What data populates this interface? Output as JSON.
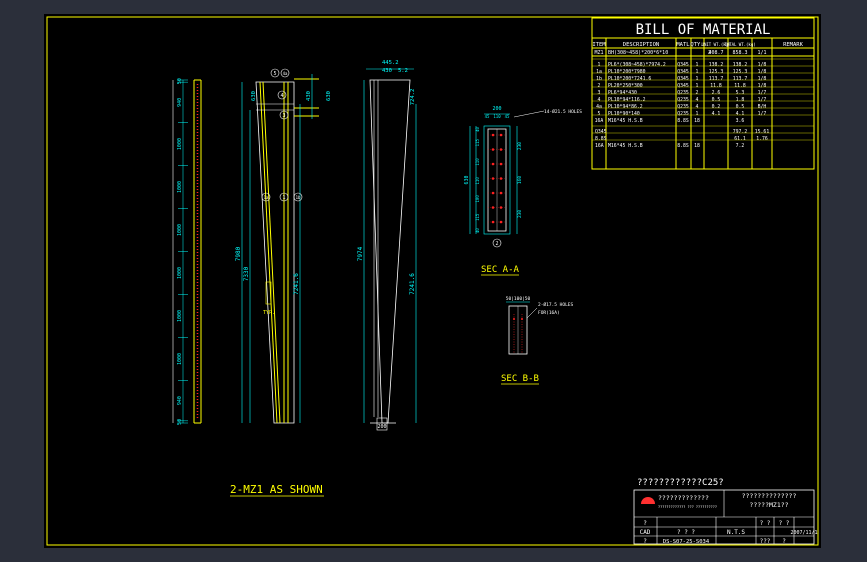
{
  "bom": {
    "title": "BILL OF MATERIAL",
    "headers": [
      "ITEM",
      "DESCRIPTION",
      "MATL",
      "QTY.",
      "UNIT WT.(kg)",
      "TOTAL WT.(kg)",
      "REMARK"
    ],
    "subheader": {
      "item": "MZ1",
      "desc": "BH(308~458)*200*6*10",
      "qty": "2",
      "unit": "408.7",
      "total": "858.3",
      "remark": "1/1"
    },
    "rows": [
      {
        "item": "1",
        "desc": "PL6*(308~458)*7974.2",
        "matl": "Q345",
        "qty": "1",
        "unit": "138.2",
        "total": "138.2",
        "remark": "1/8"
      },
      {
        "item": "1a",
        "desc": "PL10*200*7980",
        "matl": "Q345",
        "qty": "1",
        "unit": "125.3",
        "total": "125.3",
        "remark": "1/8"
      },
      {
        "item": "1b",
        "desc": "PL10*200*7241.6",
        "matl": "Q345",
        "qty": "1",
        "unit": "113.7",
        "total": "113.7",
        "remark": "1/8"
      },
      {
        "item": "2",
        "desc": "PL20*250*300",
        "matl": "Q345",
        "qty": "1",
        "unit": "11.8",
        "total": "11.8",
        "remark": "1/8"
      },
      {
        "item": "3",
        "desc": "PL6*94*430",
        "matl": "Q235",
        "qty": "2",
        "unit": "2.6",
        "total": "5.3",
        "remark": "1/7"
      },
      {
        "item": "4",
        "desc": "PL10*94*116.2",
        "matl": "Q235",
        "qty": "4",
        "unit": "0.5",
        "total": "1.8",
        "remark": "1/7"
      },
      {
        "item": "4a",
        "desc": "PL10*94*86.2",
        "matl": "Q235",
        "qty": "4",
        "unit": "0.2",
        "total": "0.5",
        "remark": "B/H"
      },
      {
        "item": "5",
        "desc": "PL10*90*140",
        "matl": "Q235",
        "qty": "1",
        "unit": "4.1",
        "total": "4.1",
        "remark": "1/7"
      },
      {
        "item": "16A",
        "desc": "M16*45 H.S.B",
        "matl": "8.8S",
        "qty": "18",
        "unit": "",
        "total": "3.6",
        "remark": ""
      }
    ],
    "totals": [
      {
        "label": "Q345",
        "unit": "",
        "total": "797.2",
        "remark": "15.61"
      },
      {
        "label": "8.8S",
        "unit": "",
        "total": "61.1",
        "remark": "1.76"
      },
      {
        "label": "16A",
        "desc": "M16*45 H.S.B",
        "matl": "8.8S",
        "qty": "18",
        "total": "7.2",
        "remark": ""
      }
    ]
  },
  "labels": {
    "main_title": "2-MZ1 AS SHOWN",
    "sec_a": "SEC A-A",
    "sec_b": "SEC B-B",
    "holes_a": "14-Ø21.5 HOLES",
    "holes_b": "2-Ø17.5 HOLES",
    "for_bolt": "FOR(16A)",
    "typ": "TYP."
  },
  "dims": {
    "left_col": [
      "50",
      "940",
      "1000",
      "1000",
      "1000",
      "1000",
      "1000",
      "1000",
      "940",
      "50"
    ],
    "elev_top": [
      "630",
      "430",
      "630"
    ],
    "elev_left": "7980",
    "elev_left2": "7330",
    "elev_right": "7241.6",
    "side_top": [
      "445.2",
      "430",
      "5.2"
    ],
    "side_left": "7974",
    "side_right": "7241.6",
    "side_top2": "724.2",
    "side_bottom": "200",
    "sec_a_top": [
      "200",
      "45",
      "110",
      "45"
    ],
    "sec_a_left": [
      "40",
      "115",
      "110",
      "110",
      "100",
      "115",
      "40"
    ],
    "sec_a_height": "630",
    "sec_a_right": [
      "230",
      "160",
      "230"
    ],
    "sec_b_top": "50|100|50"
  },
  "markers": {
    "m1": "1",
    "m1a": "1a",
    "m1b": "1b",
    "m2": "2",
    "m3": "3",
    "m4": "4",
    "m4a": "4a",
    "m5": "5",
    "m5b": "5"
  },
  "title_block": {
    "strength": "????????????C25?",
    "company": "?????????????",
    "company_sub": "????????????? ??? ??????????",
    "project": "??????????????",
    "project_sub": "?????MZ1??",
    "cad_label": "CAD",
    "scale_label": "N.T.S",
    "col1": "? ? ?",
    "col2": "? ?",
    "col3": "? ?",
    "date": "2007/11/1",
    "drawing_no": "DS-S07-25-S034",
    "rev_q1": "?",
    "rev_q2": "???",
    "rev_q3": "?",
    "row2": "?"
  }
}
